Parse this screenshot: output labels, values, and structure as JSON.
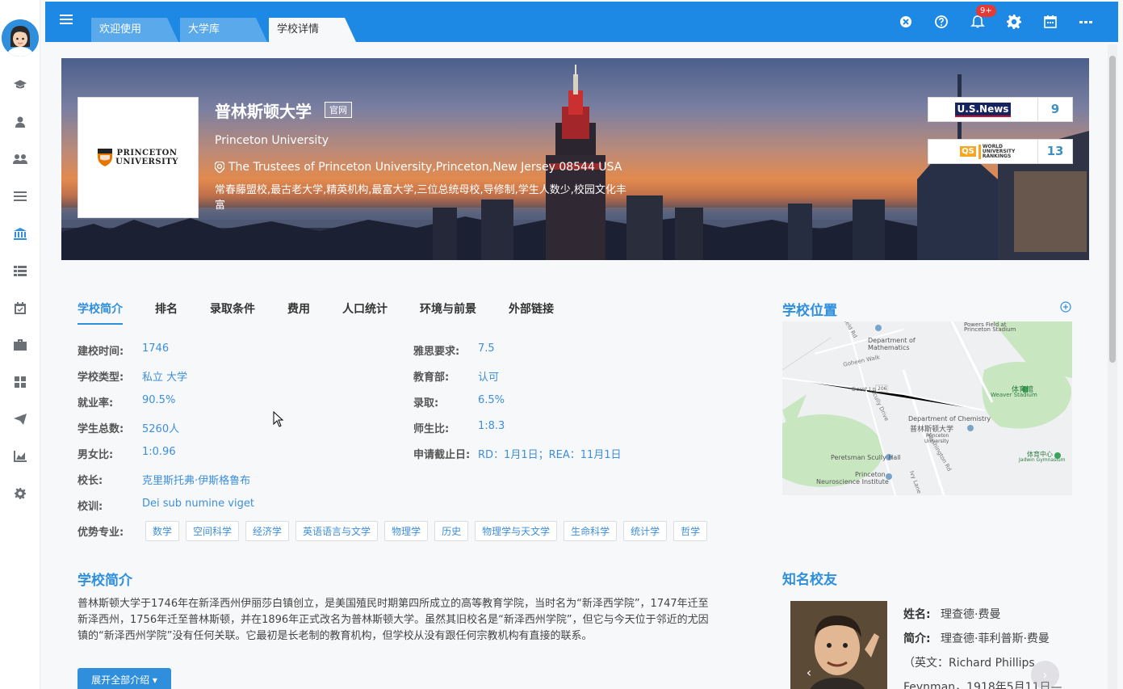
{
  "tabs": [
    {
      "label": "欢迎使用"
    },
    {
      "label": "大学库"
    },
    {
      "label": "学校详情"
    }
  ],
  "notifications": {
    "badge": "9+"
  },
  "university": {
    "name_cn": "普林斯顿大学",
    "official_label": "官网",
    "name_en": "Princeton University",
    "address": "The Trustees of Princeton University,Princeton,New Jersey 08544 USA",
    "tags": "常春藤盟校,最古老大学,精英机构,最富大学,三位总统母校,导修制,学生人数少,校园文化丰富",
    "logo_text_line1": "PRINCETON",
    "logo_text_line2": "UNIVERSITY"
  },
  "rankings": [
    {
      "source": "U.S.News",
      "value": "9"
    },
    {
      "source": "QS",
      "value": "13",
      "subtitle": "WORLD UNIVERSITY RANKINGS"
    }
  ],
  "nav_tabs": [
    "学校简介",
    "排名",
    "录取条件",
    "费用",
    "人口统计",
    "环境与前景",
    "外部链接"
  ],
  "info_left": [
    {
      "key": "建校时间:",
      "value": "1746"
    },
    {
      "key": "学校类型:",
      "value": "私立 大学"
    },
    {
      "key": "就业率:",
      "value": "90.5%"
    },
    {
      "key": "学生总数:",
      "value": "5260人"
    },
    {
      "key": "男女比:",
      "value": "1:0.96"
    },
    {
      "key": "校长:",
      "value": "克里斯托弗·伊斯格鲁布"
    },
    {
      "key": "校训:",
      "value": "Dei sub numine viget"
    }
  ],
  "info_right": [
    {
      "key": "雅思要求:",
      "value": "7.5"
    },
    {
      "key": "教育部:",
      "value": "认可"
    },
    {
      "key": "录取:",
      "value": "6.5%"
    },
    {
      "key": "师生比:",
      "value": "1:8.3"
    },
    {
      "key": "申请截止日:",
      "value": "RD：1月1日；REA：11月1日"
    }
  ],
  "majors_label": "优势专业:",
  "majors": [
    "数学",
    "空间科学",
    "经济学",
    "英语语言与文学",
    "物理学",
    "历史",
    "物理学与天文学",
    "生命科学",
    "统计学",
    "哲学"
  ],
  "intro": {
    "title": "学校简介",
    "text": "普林斯顿大学于1746年在新泽西州伊丽莎白镇创立，是美国殖民时期第四所成立的高等教育学院，当时名为“新泽西学院”，1747年迁至新泽西州，1756年迁至普林斯顿，并在1896年正式改名为普林斯顿大学。虽然其旧校名是“新泽西州学院”，但它与今天位于邻近的尤因镇的“新泽西州学院”没有任何关联。它最初是长老制的教育机构，但学校从没有跟任何宗教机构有直接的联系。",
    "more_button": "展开全部介绍"
  },
  "location": {
    "title": "学校位置",
    "map_labels": {
      "princeton_stadium": "Princeton Stadium",
      "powers_field": "Powers Field at",
      "math_dept_1": "Department of",
      "math_dept_2": "Mathematics",
      "goheen_walk": "Goheen Walk",
      "field_rd": "Field Rd",
      "dorot_ln": "Dorot Ln",
      "route_num": "206",
      "scully_drive": "Scully Drive",
      "gym_cn": "体育馆",
      "weaver_stadium": "Weaver Stadium",
      "chem_dept": "Department of Chemistry",
      "princeton_cn": "普林斯顿大学",
      "princeton_univ_1": "Princeton",
      "princeton_univ_2": "University",
      "peretsman": "Peretsman Scully Hall",
      "washington_rd": "Washington Rd",
      "sports_center_cn": "体育中心",
      "jadwin": "Jadwin Gymnasium",
      "neuro_1": "Princeton",
      "neuro_2": "Neuroscience Institute",
      "ivy_ln": "Ivy Lane"
    }
  },
  "alumni": {
    "title": "知名校友",
    "name_key": "姓名:",
    "name_value": "理查德·费曼",
    "bio_key": "简介:",
    "bio_value": "理查德·菲利普斯·费曼",
    "bio_line2": "（英文：Richard Phillips",
    "bio_line3": "Feynman，1918年5月11日—"
  },
  "colors": {
    "accent": "#2f8fdd",
    "topbar": "#1e88e5",
    "badge": "#e53935"
  }
}
